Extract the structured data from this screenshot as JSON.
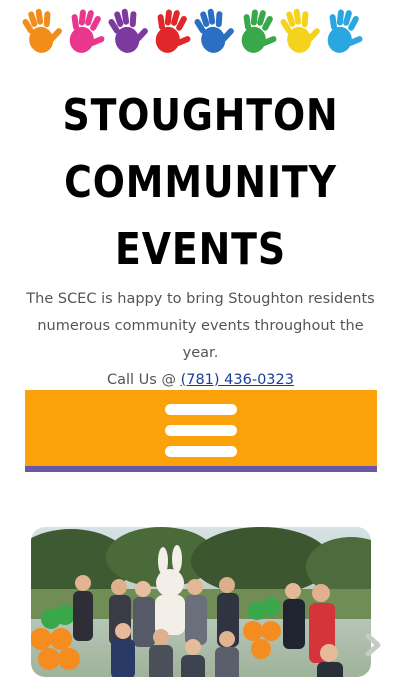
{
  "header": {
    "logo_icon": "colorful-handprints-banner",
    "handprint_colors": [
      "#f28c1a",
      "#e8378c",
      "#7c3a9f",
      "#e0282a",
      "#2a6fc2",
      "#39a84a",
      "#f5d21b",
      "#2aa6e0"
    ]
  },
  "title": {
    "line1": "STOUGHTON",
    "line2": "COMMUNITY",
    "line3": "EVENTS"
  },
  "intro": {
    "text": "The SCEC is happy to bring Stoughton residents numerous community events throughout the year.",
    "call_label": "Call Us @",
    "phone": "(781) 436-0323"
  },
  "menu": {
    "icon": "hamburger-menu-icon",
    "background": "#fba10a",
    "accent": "#6b56a5"
  },
  "gallery": {
    "photo_icon": "community-event-group-photo",
    "next_icon": "chevron-right-icon"
  }
}
